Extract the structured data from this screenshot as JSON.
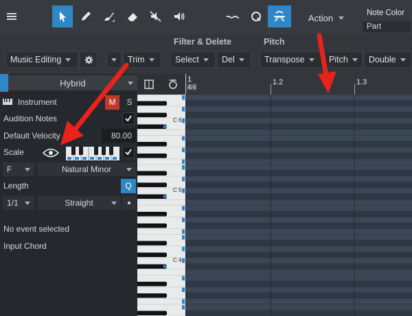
{
  "toolbar": {
    "action_label": "Action",
    "note_color_label": "Note Color",
    "note_color_value": "Part"
  },
  "groups": {
    "filter_delete": "Filter & Delete",
    "pitch": "Pitch"
  },
  "row2": {
    "mode": "Music Editing",
    "trim": "Trim",
    "select": "Select",
    "del": "Del",
    "transpose": "Transpose",
    "pitch": "Pitch",
    "double": "Double"
  },
  "inspector": {
    "preset": "Hybrid",
    "instrument": "Instrument",
    "mute": "M",
    "solo": "S",
    "audition": "Audition Notes",
    "velocity_label": "Default Velocity",
    "velocity_value": "80.00",
    "scale": "Scale",
    "root": "F",
    "scale_type": "Natural Minor",
    "length": "Length",
    "quantize": "Q",
    "length_value": "1/1",
    "length_mode": "Straight",
    "no_event": "No event selected",
    "input_chord": "Input Chord"
  },
  "ruler": {
    "bar1": "1",
    "timesig": "4/4",
    "bar12": "1.2",
    "bar13": "1.3"
  },
  "keys": {
    "c6": "C 6",
    "c5": "C 5",
    "c4": "C 4"
  },
  "colors": {
    "accent": "#2e88c8",
    "arrow": "#e8231b",
    "mute": "#c0392b"
  },
  "icons": [
    "menu-icon",
    "arrow-tool-icon",
    "pencil-tool-icon",
    "paint-tool-icon",
    "eraser-tool-icon",
    "mute-tool-icon",
    "listen-tool-icon",
    "bend-icon",
    "quantize-icon",
    "split-icon",
    "gear-icon",
    "eye-icon",
    "keyboard-icon",
    "loop-icon"
  ]
}
